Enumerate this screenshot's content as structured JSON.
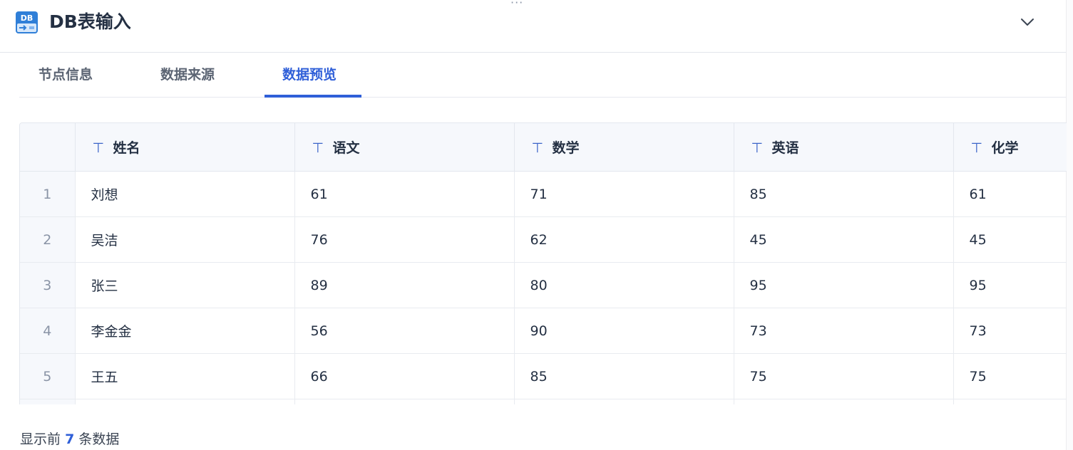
{
  "header": {
    "icon_text": "DB",
    "title": "DB表输入"
  },
  "tabs": [
    {
      "label": "节点信息"
    },
    {
      "label": "数据来源"
    },
    {
      "label": "数据预览"
    }
  ],
  "active_tab": "数据预览",
  "table": {
    "columns": [
      "姓名",
      "语文",
      "数学",
      "英语",
      "化学"
    ],
    "rows": [
      {
        "index": "1",
        "cells": [
          "刘想",
          "61",
          "71",
          "85",
          "61"
        ]
      },
      {
        "index": "2",
        "cells": [
          "吴洁",
          "76",
          "62",
          "45",
          "45"
        ]
      },
      {
        "index": "3",
        "cells": [
          "张三",
          "89",
          "80",
          "95",
          "95"
        ]
      },
      {
        "index": "4",
        "cells": [
          "李金金",
          "56",
          "90",
          "73",
          "73"
        ]
      },
      {
        "index": "5",
        "cells": [
          "王五",
          "66",
          "85",
          "75",
          "75"
        ]
      },
      {
        "index": "",
        "cells": [
          "",
          "",
          "",
          "",
          ""
        ]
      }
    ]
  },
  "footer": {
    "prefix": "显示前",
    "count": "7",
    "suffix": "条数据"
  },
  "colors": {
    "accent": "#2f5fd8",
    "header_bg": "#f6f8fc",
    "border": "#e3e7ee"
  },
  "icons": {
    "collapse": "chevron-down-icon",
    "column_type": "text-type-icon",
    "more": "more-dots-icon"
  }
}
